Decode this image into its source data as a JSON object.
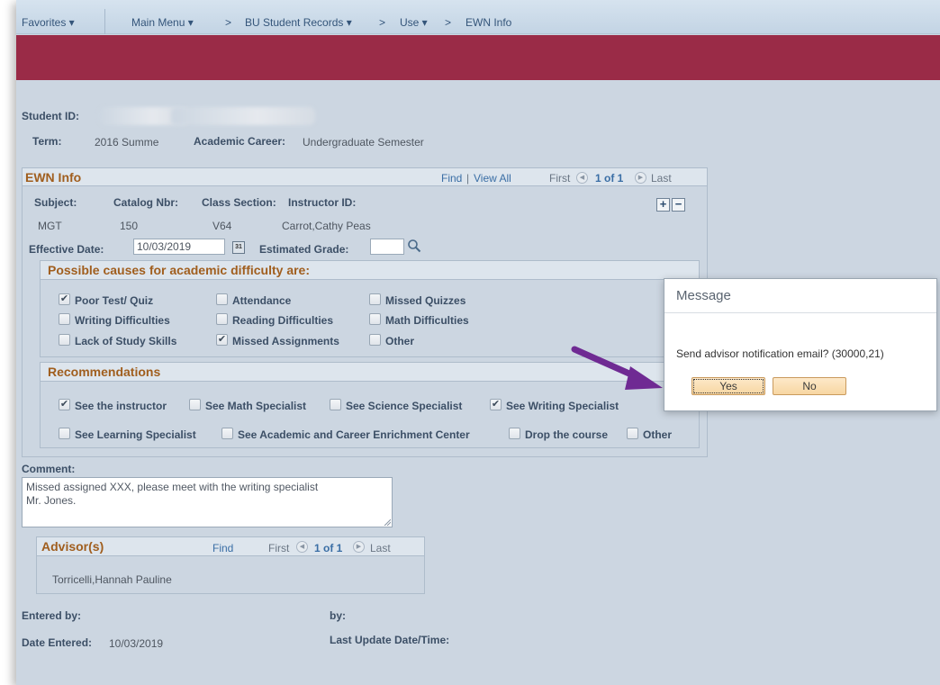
{
  "nav": {
    "favorites": "Favorites ▾",
    "main_menu": "Main Menu ▾",
    "sep": ">",
    "bu_student_records": "BU Student Records ▾",
    "use": "Use ▾",
    "ewn_info": "EWN Info"
  },
  "student": {
    "id_label": "Student ID:",
    "term_label": "Term:",
    "term_value": "2016 Summe",
    "career_label": "Academic Career:",
    "career_value": "Undergraduate Semester"
  },
  "ewn": {
    "title": "EWN Info",
    "find": "Find",
    "pipe": "|",
    "view_all": "View All",
    "first": "First",
    "count": "1 of 1",
    "last": "Last",
    "subject_label": "Subject:",
    "catalog_label": "Catalog Nbr:",
    "section_label": "Class Section:",
    "instructor_label": "Instructor ID:",
    "subject": "MGT",
    "catalog": "150",
    "section": "V64",
    "instructor": "Carrot,Cathy Peas",
    "effective_date_label": "Effective Date:",
    "effective_date": "10/03/2019",
    "calendar_glyph": "31",
    "estimated_grade_label": "Estimated Grade:",
    "plus": "+",
    "minus": "−"
  },
  "causes": {
    "title": "Possible causes for academic difficulty are:",
    "items": [
      {
        "label": "Poor Test/ Quiz",
        "checked": true,
        "mark": "✔"
      },
      {
        "label": "Attendance",
        "checked": false,
        "mark": ""
      },
      {
        "label": "Missed Quizzes",
        "checked": false,
        "mark": ""
      },
      {
        "label": "Writing Difficulties",
        "checked": false,
        "mark": ""
      },
      {
        "label": "Reading Difficulties",
        "checked": false,
        "mark": ""
      },
      {
        "label": "Math Difficulties",
        "checked": false,
        "mark": ""
      },
      {
        "label": "Lack of Study Skills",
        "checked": false,
        "mark": ""
      },
      {
        "label": "Missed Assignments",
        "checked": true,
        "mark": "✔"
      },
      {
        "label": "Other",
        "checked": false,
        "mark": ""
      }
    ]
  },
  "recommendations": {
    "title": "Recommendations",
    "items": [
      {
        "label": "See the instructor",
        "checked": true,
        "mark": "✔"
      },
      {
        "label": "See Math Specialist",
        "checked": false,
        "mark": ""
      },
      {
        "label": "See Science Specialist",
        "checked": false,
        "mark": ""
      },
      {
        "label": "See Writing Specialist",
        "checked": true,
        "mark": "✔"
      },
      {
        "label": "See Learning Specialist",
        "checked": false,
        "mark": ""
      },
      {
        "label": "See Academic and Career Enrichment Center",
        "checked": false,
        "mark": ""
      },
      {
        "label": "Drop the course",
        "checked": false,
        "mark": ""
      },
      {
        "label": "Other",
        "checked": false,
        "mark": ""
      }
    ]
  },
  "comment": {
    "label": "Comment:",
    "value": "Missed assigned XXX, please meet with the writing specialist\nMr. Jones."
  },
  "advisors": {
    "title": "Advisor(s)",
    "find": "Find",
    "first": "First",
    "count": "1 of 1",
    "last": "Last",
    "name": "Torricelli,Hannah Pauline"
  },
  "footer": {
    "entered_by_label": "Entered by:",
    "by_label": "by:",
    "date_entered_label": "Date Entered:",
    "date_entered": "10/03/2019",
    "last_update_label": "Last Update Date/Time:"
  },
  "dialog": {
    "title": "Message",
    "message": "Send advisor notification email? (30000,21)",
    "yes": "Yes",
    "no": "No"
  },
  "colors": {
    "accent": "#9a2b47",
    "arrow": "#6f2a93",
    "section_title": "#a05e1e"
  }
}
